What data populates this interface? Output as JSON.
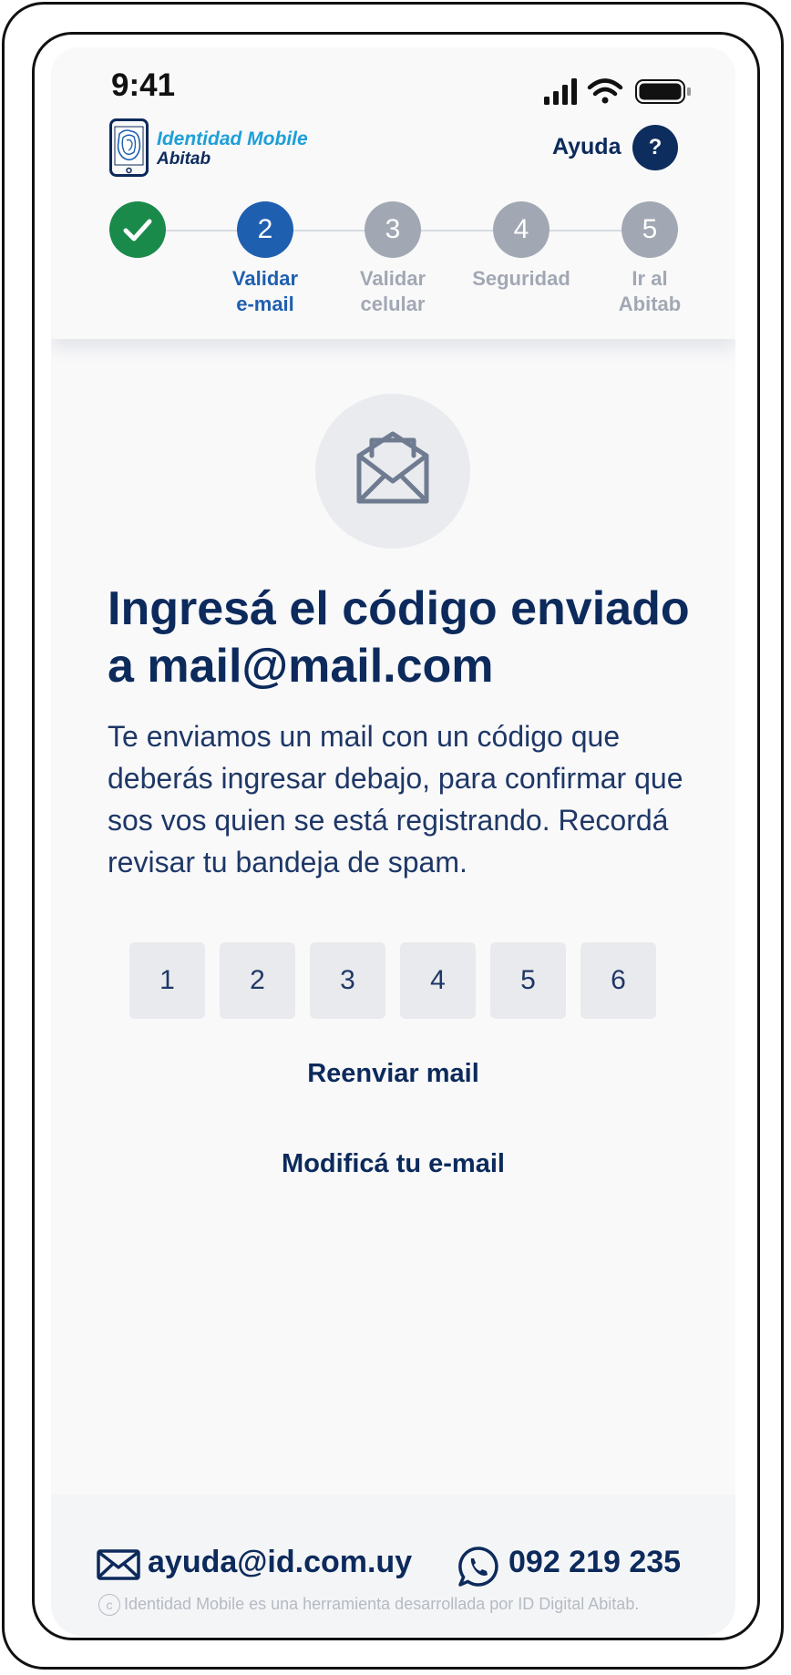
{
  "status_bar": {
    "time": "9:41",
    "icons": [
      "signal-icon",
      "wifi-icon",
      "battery-icon"
    ]
  },
  "header": {
    "logo": {
      "line1": "Identidad Mobile",
      "line2": "Abitab"
    },
    "help_label": "Ayuda",
    "help_button_symbol": "?"
  },
  "steps": [
    {
      "number": "1",
      "label": "",
      "state": "done"
    },
    {
      "number": "2",
      "label": "Validar\ne-mail",
      "state": "active"
    },
    {
      "number": "3",
      "label": "Validar\ncelular",
      "state": "pending"
    },
    {
      "number": "4",
      "label": "Seguridad",
      "state": "pending"
    },
    {
      "number": "5",
      "label": "Ir al\nAbitab",
      "state": "pending"
    }
  ],
  "main": {
    "icon": "envelope-open-icon",
    "title": "Ingresá el código enviado a mail@mail.com",
    "subtitle": "Te enviamos un mail con un código que deberás ingresar debajo, para confirmar que sos vos quien se está registrando. Recordá revisar tu bandeja de spam.",
    "code_digits": [
      "1",
      "2",
      "3",
      "4",
      "5",
      "6"
    ],
    "resend_link": "Reenviar mail",
    "modify_link": "Modificá tu e-mail"
  },
  "footer": {
    "email": "ayuda@id.com.uy",
    "phone": "092 219 235",
    "disclaimer": "Identidad Mobile es una herramienta desarrollada por ID Digital Abitab.",
    "copyright_symbol": "c"
  },
  "colors": {
    "primary_navy": "#0c2a5b",
    "active_blue": "#1f5fb0",
    "success_green": "#1a8a4a",
    "pending_gray": "#a2a8b3",
    "logo_cyan": "#1e9fd8"
  }
}
